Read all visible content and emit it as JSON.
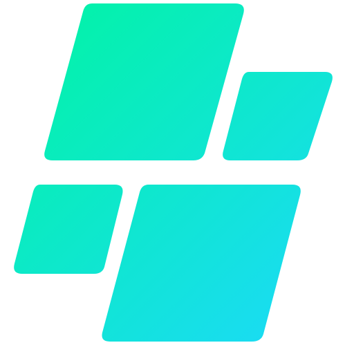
{
  "logo": {
    "icon_name": "four-parallelogram-tiles-logo-icon",
    "colors": {
      "gradient_start": "#00F5A0",
      "gradient_end": "#1ED8FF",
      "background": "#FFFFFF"
    }
  }
}
